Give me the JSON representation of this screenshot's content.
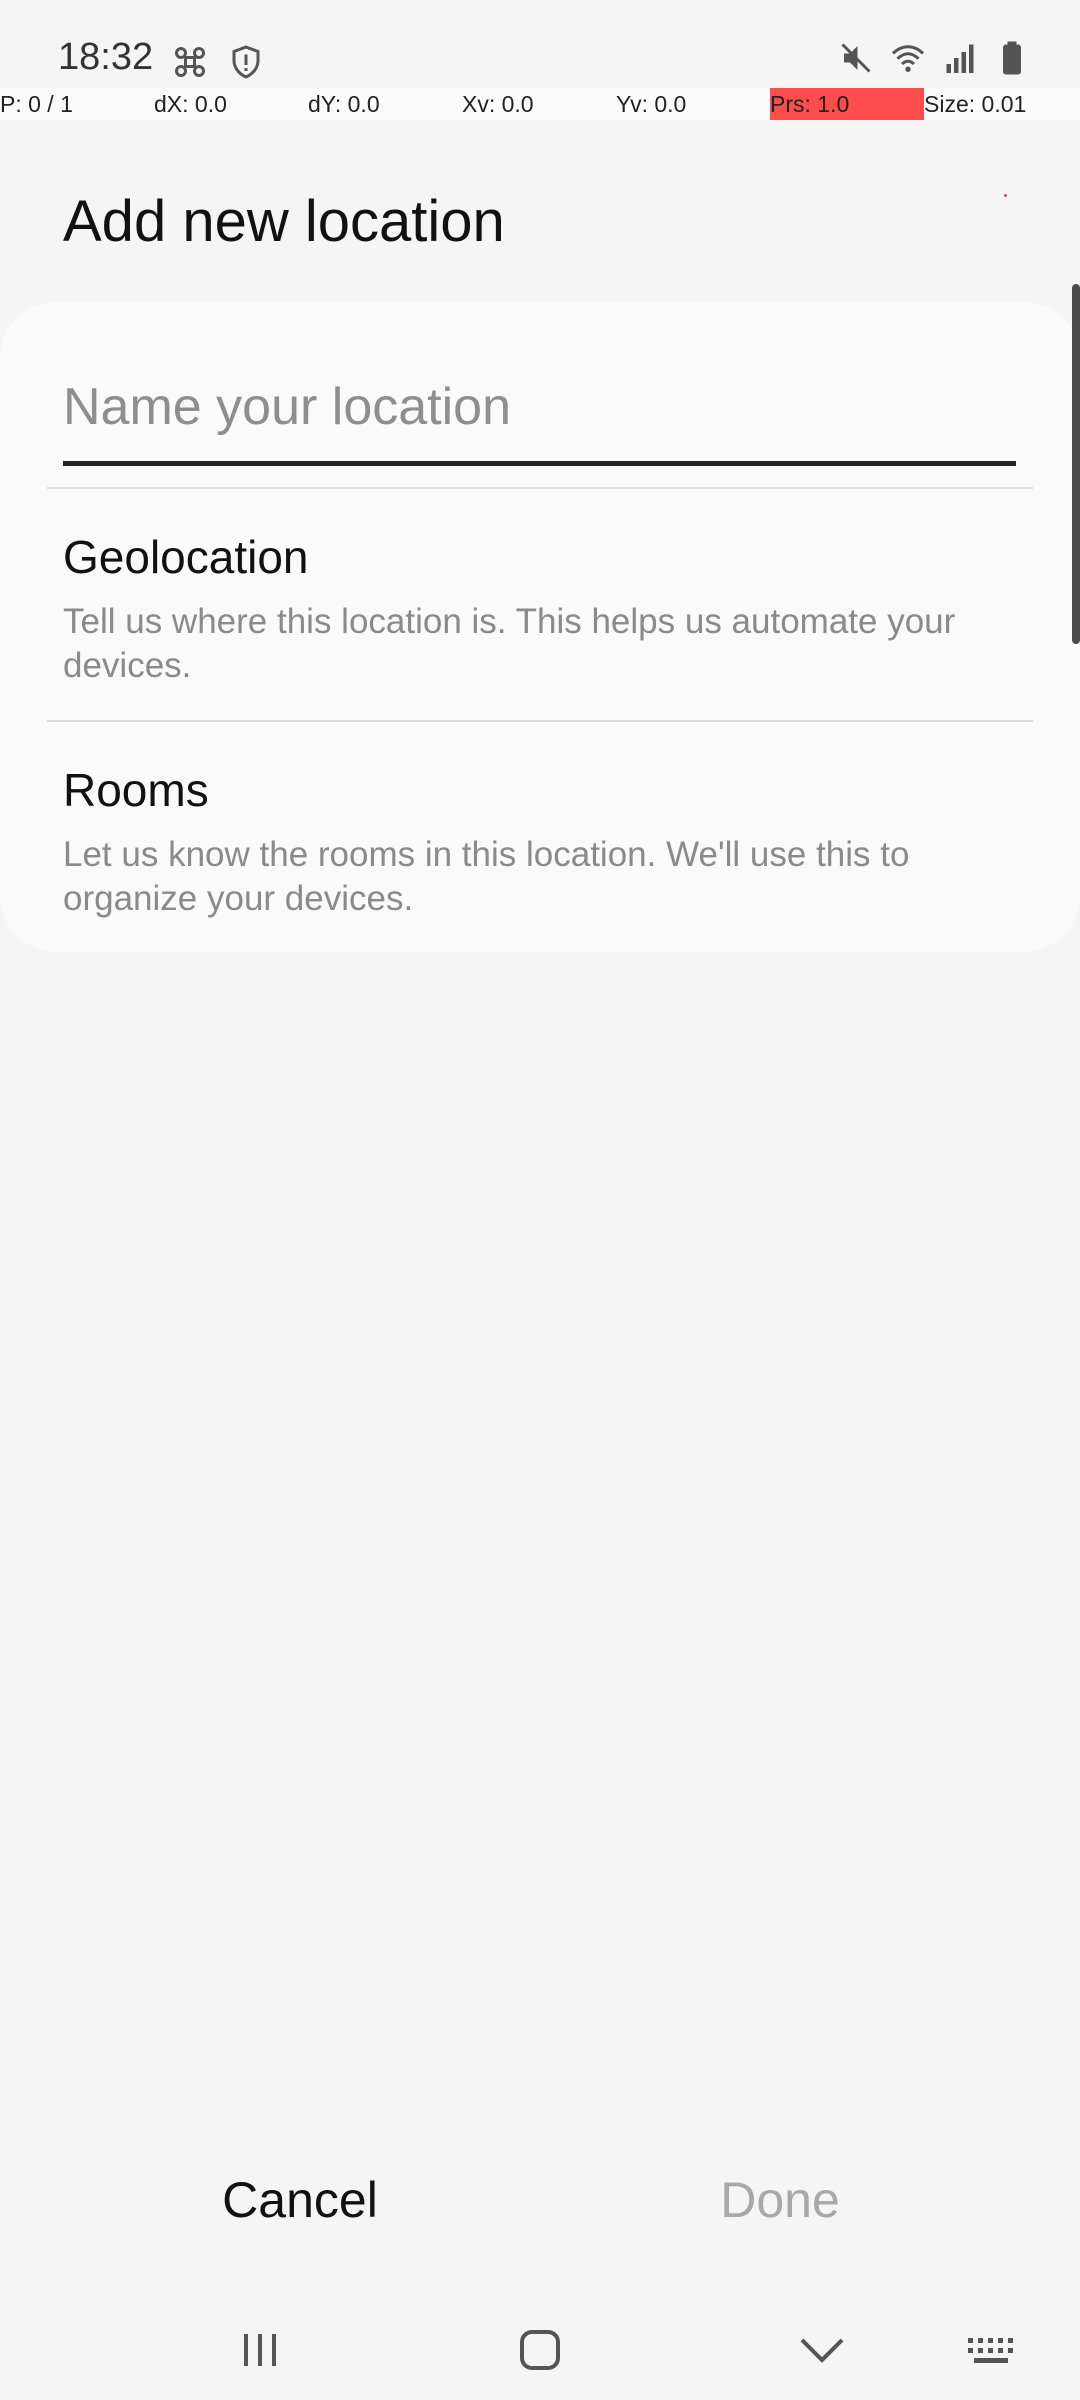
{
  "status_bar": {
    "time": "18:32",
    "left_icons": [
      "cluster-icon",
      "shield-alert-icon"
    ],
    "right_icons": [
      "mute-icon",
      "wifi-icon",
      "signal-icon",
      "battery-icon"
    ]
  },
  "debug_overlay": {
    "cells": [
      "P: 0 / 1",
      "dX: 0.0",
      "dY: 0.0",
      "Xv: 0.0",
      "Yv: 0.0",
      "Prs: 1.0",
      "Size: 0.01"
    ]
  },
  "header": {
    "title": "Add new location"
  },
  "form": {
    "name_placeholder": "Name your location",
    "name_value": ""
  },
  "sections": [
    {
      "title": "Geolocation",
      "description": "Tell us where this location is. This helps us automate your devices."
    },
    {
      "title": "Rooms",
      "description": "Let us know the rooms in this location. We'll use this to organize your devices."
    }
  ],
  "actions": {
    "cancel_label": "Cancel",
    "done_label": "Done"
  },
  "nav_bar": {
    "buttons": [
      "recent-apps-icon",
      "home-icon",
      "back-icon",
      "keyboard-icon"
    ]
  },
  "colors": {
    "background": "#f5f5f5",
    "card": "#fafafa",
    "debug_highlight": "#ff4d4d",
    "disabled_text": "#a8a8a8"
  }
}
